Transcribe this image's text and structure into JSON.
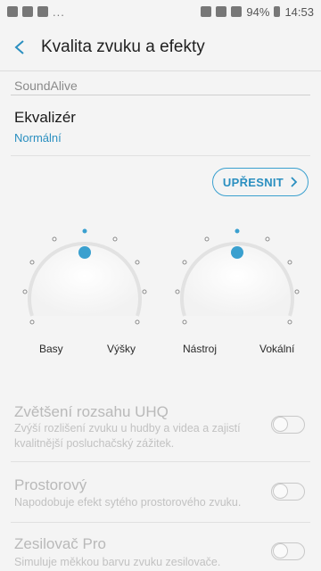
{
  "statusbar": {
    "battery": "94%",
    "time": "14:53",
    "overflow": "..."
  },
  "header": {
    "title": "Kvalita zvuku a efekty"
  },
  "section": {
    "label": "SoundAlive"
  },
  "equalizer": {
    "title": "Ekvalizér",
    "value": "Normální"
  },
  "upresnit": {
    "label": "UPŘESNIT"
  },
  "dials": [
    {
      "left_label": "Basy",
      "right_label": "Výšky",
      "level": 0.5
    },
    {
      "left_label": "Nástroj",
      "right_label": "Vokální",
      "level": 0.5
    }
  ],
  "settings": [
    {
      "title": "Zvětšení rozsahu UHQ",
      "description": "Zvýší rozlišení zvuku u hudby a videa a zajistí kvalitnější posluchačský zážitek.",
      "enabled": false
    },
    {
      "title": "Prostorový",
      "description": "Napodobuje efekt sytého prostorového zvuku.",
      "enabled": false
    },
    {
      "title": "Zesilovač Pro",
      "description": "Simuluje měkkou barvu zvuku zesilovače.",
      "enabled": false
    }
  ],
  "colors": {
    "accent": "#2a8fc0",
    "disabled_text": "#b9b9b9"
  }
}
